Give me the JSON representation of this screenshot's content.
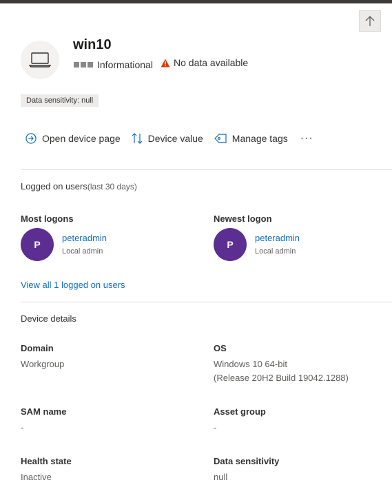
{
  "device": {
    "name": "win10",
    "severity": "Informational",
    "status": "No data available",
    "sensitivity_tag": "Data sensitivity: null"
  },
  "actions": {
    "open_device_page": "Open device page",
    "device_value": "Device value",
    "manage_tags": "Manage tags",
    "more": "···"
  },
  "logged_on_users": {
    "title": "Logged on users",
    "subtitle": "(last 30 days)",
    "most_logons": {
      "heading": "Most logons",
      "initial": "P",
      "name": "peteradmin",
      "role": "Local admin"
    },
    "newest_logon": {
      "heading": "Newest logon",
      "initial": "P",
      "name": "peteradmin",
      "role": "Local admin"
    },
    "view_all": "View all 1 logged on users"
  },
  "device_details": {
    "title": "Device details",
    "domain": {
      "label": "Domain",
      "value": "Workgroup"
    },
    "os": {
      "label": "OS",
      "value_line1": "Windows 10 64-bit",
      "value_line2": "(Release 20H2 Build 19042.1288)"
    },
    "sam_name": {
      "label": "SAM name",
      "value": "-"
    },
    "asset_group": {
      "label": "Asset group",
      "value": "-"
    },
    "health_state": {
      "label": "Health state",
      "value": "Inactive"
    },
    "data_sensitivity": {
      "label": "Data sensitivity",
      "value": "null"
    }
  },
  "colors": {
    "accent_link": "#0f6cbd",
    "avatar_purple": "#5c2e91",
    "warning": "#d83b01"
  },
  "icons": {
    "scroll_top": "arrow-up-icon",
    "device": "laptop-icon",
    "warning": "warning-triangle-icon",
    "open": "circle-arrow-right-icon",
    "value": "up-down-arrows-icon",
    "tags": "tag-icon"
  }
}
